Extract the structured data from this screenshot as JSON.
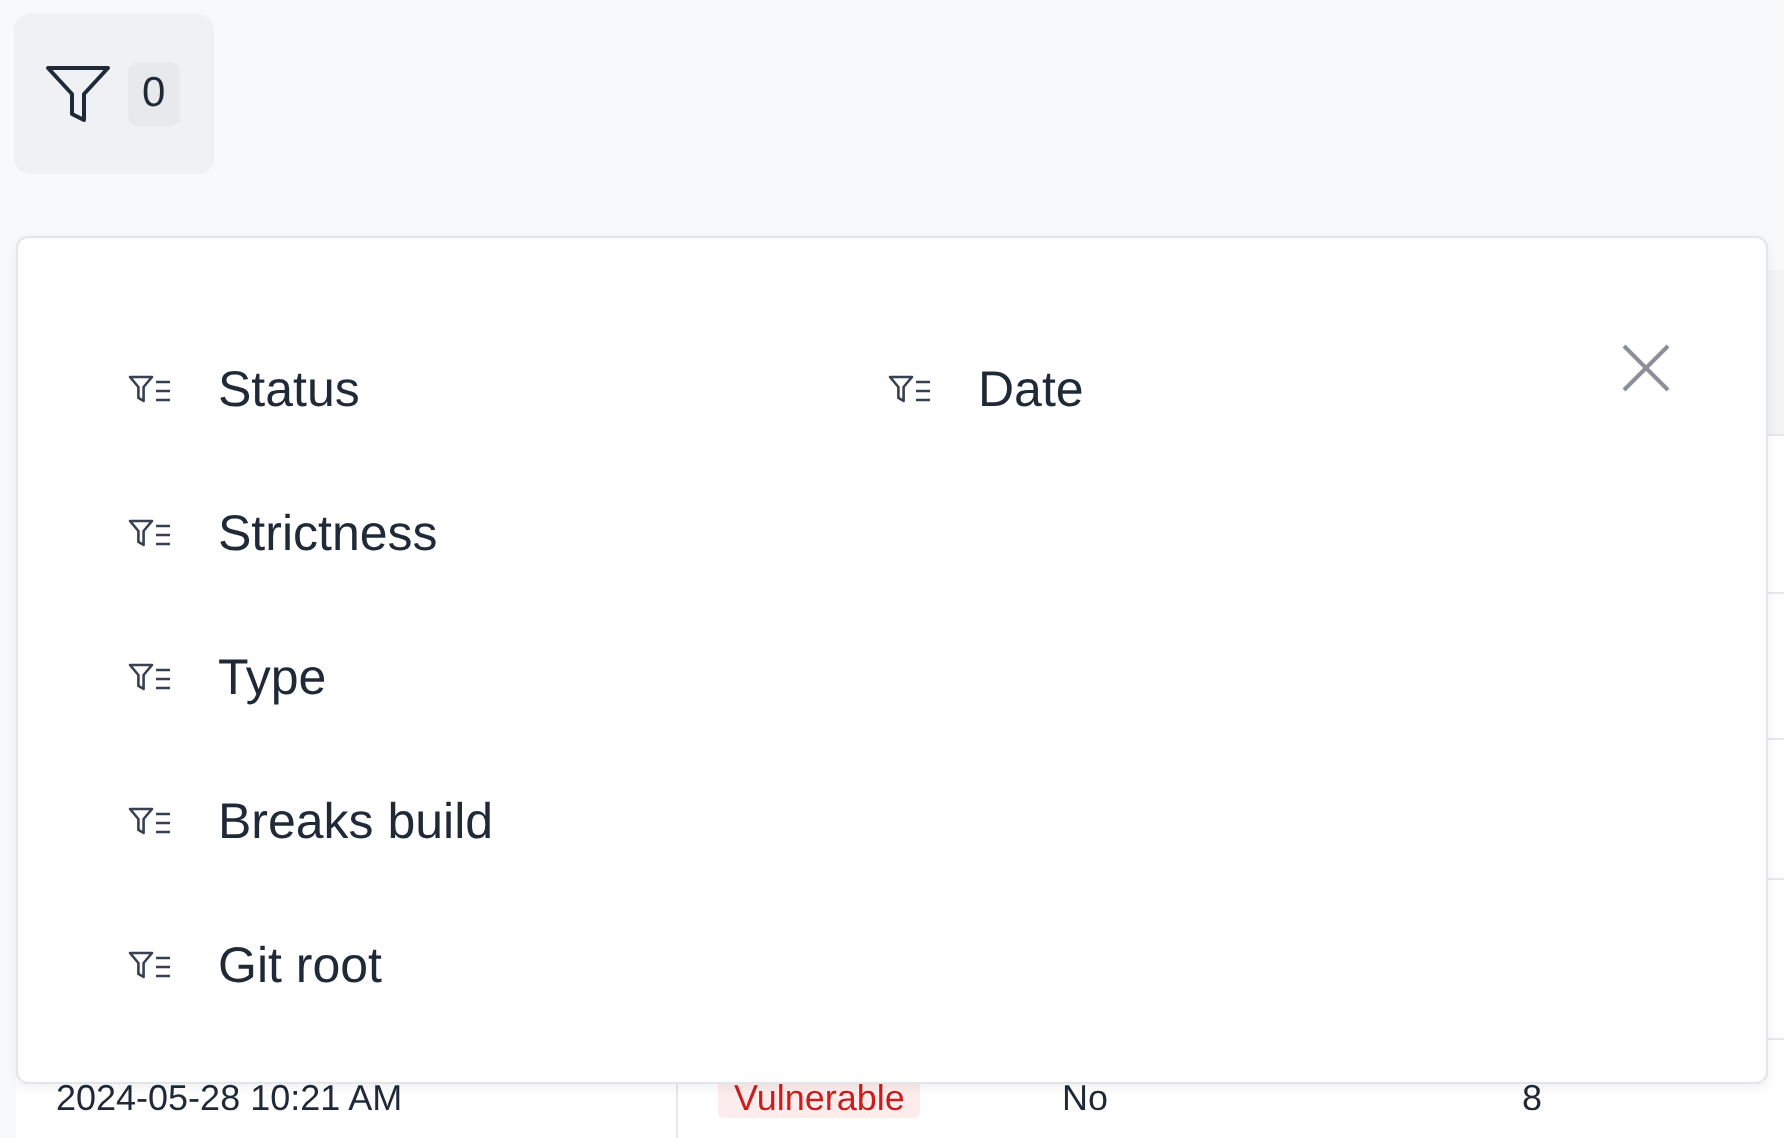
{
  "filter_button": {
    "count": "0"
  },
  "filter_panel": {
    "columns": [
      {
        "items": [
          {
            "label": "Status"
          },
          {
            "label": "Strictness"
          },
          {
            "label": "Type"
          },
          {
            "label": "Breaks build"
          },
          {
            "label": "Git root"
          }
        ]
      },
      {
        "items": [
          {
            "label": "Date"
          }
        ]
      }
    ]
  },
  "table": {
    "rows": [
      {
        "cells": [
          {
            "kind": "text",
            "text": "2024-05-28 10:21 AM"
          },
          {
            "kind": "tag",
            "text": "Vulnerable"
          },
          {
            "kind": "text",
            "text": "No"
          },
          {
            "kind": "number",
            "text": "8"
          }
        ]
      }
    ]
  }
}
